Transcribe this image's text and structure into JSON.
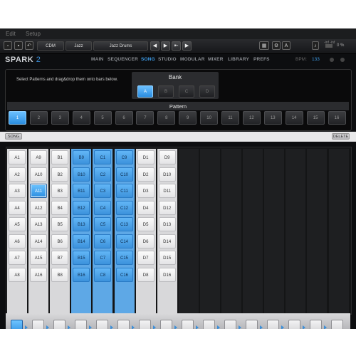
{
  "menu": {
    "edit": "Edit",
    "setup": "Setup"
  },
  "toolbar": {
    "preset_category": "CDM",
    "preset_style": "Jazz",
    "preset_name": "Jazz Drums",
    "btn_prev": "◀",
    "btn_play": "▶",
    "btn_export": "⇤",
    "btn_next": "▶",
    "level_label": "-inf  -inf",
    "volume_pct": "0 %"
  },
  "nav": {
    "logo_text": "SPARK",
    "logo_version": "2",
    "tabs": [
      "MAIN",
      "SEQUENCER",
      "SONG",
      "STUDIO",
      "MODULAR",
      "MIXER",
      "LIBRARY",
      "PREFS"
    ],
    "active_tab": "SONG",
    "bpm_label": "BPM:",
    "bpm_value": "133"
  },
  "instruction": "Select Patterns and drag&drop them onto bars below.",
  "bank": {
    "title": "Bank",
    "options": [
      "A",
      "B",
      "C",
      "D"
    ],
    "selected": "A"
  },
  "pattern": {
    "title": "Pattern",
    "options": [
      "1",
      "2",
      "3",
      "4",
      "5",
      "6",
      "7",
      "8",
      "9",
      "10",
      "11",
      "12",
      "13",
      "14",
      "15",
      "16"
    ],
    "selected": "1"
  },
  "song": {
    "label": "SONG",
    "delete_label": "DELETE"
  },
  "grid": {
    "columns": [
      {
        "style": "w",
        "cells": [
          "A1",
          "A2",
          "A3",
          "A4",
          "A5",
          "A6",
          "A7",
          "A8"
        ]
      },
      {
        "style": "w",
        "cells": [
          "A9",
          "A10",
          "A11",
          "A12",
          "A13",
          "A14",
          "A15",
          "A16"
        ]
      },
      {
        "style": "w",
        "cells": [
          "B1",
          "B2",
          "B3",
          "B4",
          "B5",
          "B6",
          "B7",
          "B8"
        ]
      },
      {
        "style": "b",
        "cells": [
          "B9",
          "B10",
          "B11",
          "B12",
          "B13",
          "B14",
          "B15",
          "B16"
        ]
      },
      {
        "style": "b",
        "cells": [
          "C1",
          "C2",
          "C3",
          "C4",
          "C5",
          "C6",
          "C7",
          "C8"
        ]
      },
      {
        "style": "b",
        "cells": [
          "C9",
          "C10",
          "C11",
          "C12",
          "C13",
          "C14",
          "C15",
          "C16"
        ]
      },
      {
        "style": "w",
        "cells": [
          "D1",
          "D2",
          "D3",
          "D4",
          "D5",
          "D6",
          "D7",
          "D8"
        ]
      },
      {
        "style": "w",
        "cells": [
          "D9",
          "D10",
          "D11",
          "D12",
          "D13",
          "D14",
          "D15",
          "D16"
        ]
      },
      {
        "style": "empty",
        "cells": []
      },
      {
        "style": "empty",
        "cells": []
      },
      {
        "style": "empty",
        "cells": []
      },
      {
        "style": "empty",
        "cells": []
      },
      {
        "style": "empty",
        "cells": []
      },
      {
        "style": "empty",
        "cells": []
      },
      {
        "style": "empty",
        "cells": []
      },
      {
        "style": "empty",
        "cells": []
      }
    ],
    "selected_cell": "A11"
  },
  "bars": {
    "count": 16,
    "selected_index": 0
  },
  "colors": {
    "accent": "#3d9be6",
    "cell_blue": "#4aa3ea",
    "background": "#0d0e10"
  }
}
